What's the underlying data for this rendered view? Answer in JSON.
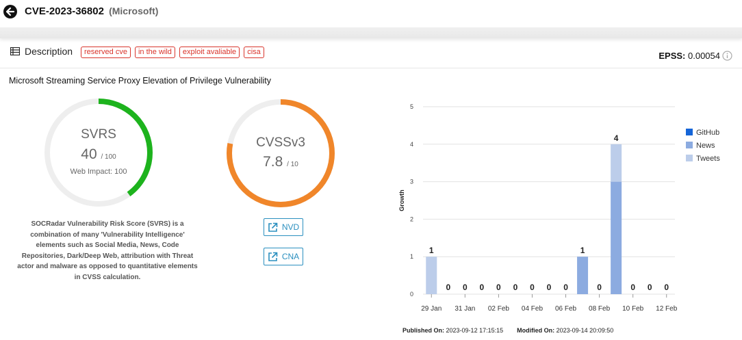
{
  "header": {
    "cve_id": "CVE-2023-36802",
    "vendor": "(Microsoft)"
  },
  "description": {
    "label": "Description",
    "tags": [
      "reserved cve",
      "in the wild",
      "exploit avaliable",
      "cisa"
    ],
    "epss_label": "EPSS:",
    "epss_value": "0.00054",
    "title": "Microsoft Streaming Service Proxy Elevation of Privilege Vulnerability"
  },
  "svrs": {
    "name": "SVRS",
    "score": "40",
    "max": "/ 100",
    "score_fraction": 0.4,
    "web_impact": "Web Impact: 100",
    "color": "#1db31d",
    "description": "SOCRadar Vulnerability Risk Score (SVRS) is a combination of many 'Vulnerability Intelligence' elements such as Social Media, News, Code Repositories, Dark/Deep Web, attribution with Threat actor and malware as opposed to quantitative elements in CVSS calculation."
  },
  "cvss": {
    "name": "CVSSv3",
    "score": "7.8",
    "max": "/ 10",
    "score_fraction": 0.78,
    "color": "#f0862a"
  },
  "links": {
    "nvd": "NVD",
    "cna": "CNA"
  },
  "chart_data": {
    "type": "bar",
    "ylabel": "Growth",
    "ylim": [
      0,
      5
    ],
    "yticks": [
      0,
      1,
      2,
      3,
      4,
      5
    ],
    "x_tick_labels": [
      "29 Jan",
      "31 Jan",
      "02 Feb",
      "04 Feb",
      "06 Feb",
      "08 Feb",
      "10 Feb",
      "12 Feb"
    ],
    "categories": [
      "29 Jan",
      "30 Jan",
      "31 Jan",
      "01 Feb",
      "02 Feb",
      "03 Feb",
      "04 Feb",
      "05 Feb",
      "06 Feb",
      "07 Feb",
      "08 Feb",
      "09 Feb",
      "10 Feb",
      "11 Feb",
      "12 Feb"
    ],
    "series": [
      {
        "name": "GitHub",
        "color": "#1565d8",
        "values": [
          0,
          0,
          0,
          0,
          0,
          0,
          0,
          0,
          0,
          0,
          0,
          0,
          0,
          0,
          0
        ]
      },
      {
        "name": "News",
        "color": "#8cabe0",
        "values": [
          0,
          0,
          0,
          0,
          0,
          0,
          0,
          0,
          0,
          1,
          0,
          3,
          0,
          0,
          0
        ]
      },
      {
        "name": "Tweets",
        "color": "#bccdea",
        "values": [
          1,
          0,
          0,
          0,
          0,
          0,
          0,
          0,
          0,
          0,
          0,
          1,
          0,
          0,
          0
        ]
      }
    ],
    "totals": [
      1,
      0,
      0,
      0,
      0,
      0,
      0,
      0,
      0,
      1,
      0,
      4,
      0,
      0,
      0
    ],
    "legend_position": "right"
  },
  "footer": {
    "published_label": "Published On:",
    "published_value": "2023-09-12 17:15:15",
    "modified_label": "Modified On:",
    "modified_value": "2023-09-14 20:09:50"
  }
}
